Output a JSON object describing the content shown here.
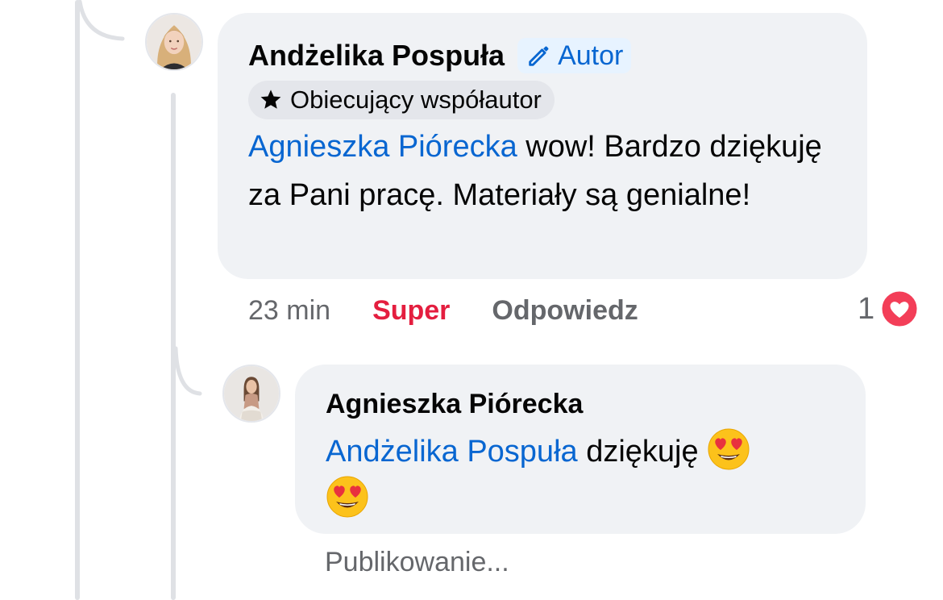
{
  "comment": {
    "author_name": "Andżelika Pospuła",
    "author_badge_label": "Autor",
    "author_badge_icon": "pencil-icon",
    "contributor_badge_label": "Obiecujący współautor",
    "contributor_badge_icon": "star-icon",
    "mention": "Agnieszka Piórecka",
    "text": " wow! Bardzo dziękuję za Pani pracę. Materiały są genialne!",
    "time": "23 min",
    "like_label": "Super",
    "reply_label": "Odpowiedz",
    "reaction_count": "1",
    "reaction_icon": "heart-icon"
  },
  "reply": {
    "author_name": "Agnieszka Piórecka",
    "mention": "Andżelika Pospuła",
    "text": " dziękuję ",
    "emoji_icon": "heart-eyes-emoji-icon",
    "status": "Publikowanie..."
  },
  "colors": {
    "bubble_bg": "#f0f2f5",
    "link_blue": "#0866d1",
    "like_red": "#e41e3f",
    "secondary_text": "#65676b",
    "thread_line": "#dfe1e5"
  }
}
